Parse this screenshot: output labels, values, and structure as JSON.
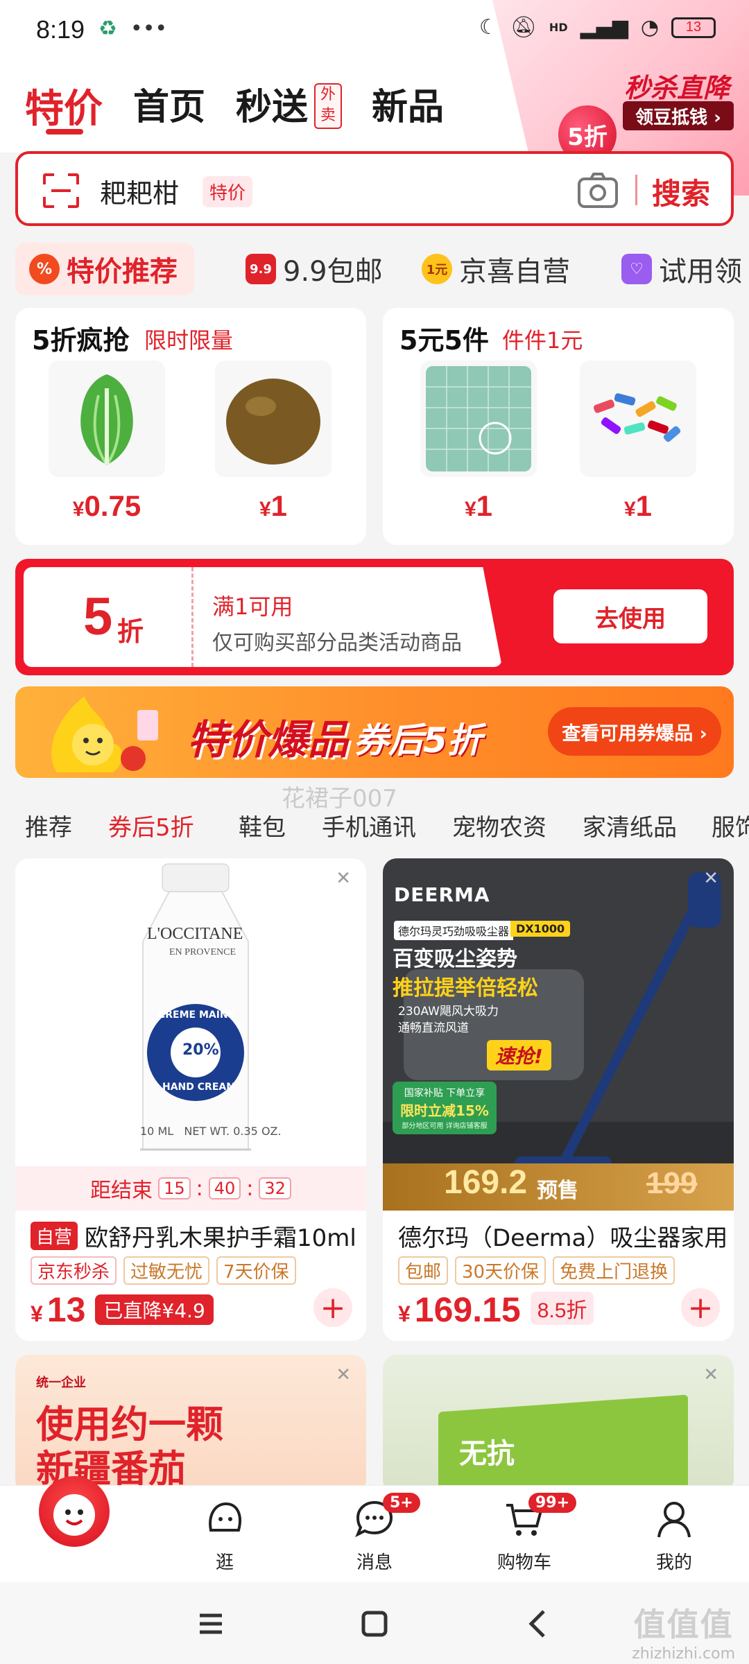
{
  "status_bar": {
    "time": "8:19",
    "battery": "13",
    "network": "HD"
  },
  "header": {
    "tabs": [
      {
        "label": "特价",
        "active": true
      },
      {
        "label": "首页"
      },
      {
        "label": "秒送"
      },
      {
        "label": "新品"
      }
    ],
    "waimai_tag": "外卖",
    "promo": {
      "badge": "5折",
      "title": "秒杀直降",
      "subtitle": "领豆抵钱 ›"
    }
  },
  "search": {
    "query": "耙耙柑",
    "tag": "特价",
    "button": "搜索"
  },
  "categories": [
    {
      "label": "特价推荐",
      "active": true
    },
    {
      "label": "9.9包邮",
      "icon_text": "9.9"
    },
    {
      "label": "京喜自营",
      "icon_text": "1元"
    },
    {
      "label": "试用领"
    }
  ],
  "deals": [
    {
      "title": "5折疯抢",
      "subtitle": "限时限量",
      "items": [
        {
          "price": "0.75",
          "currency": "¥"
        },
        {
          "price": "1",
          "currency": "¥"
        }
      ]
    },
    {
      "title": "5元5件",
      "subtitle": "件件1元",
      "items": [
        {
          "price": "1",
          "currency": "¥"
        },
        {
          "price": "1",
          "currency": "¥"
        }
      ]
    }
  ],
  "coupon": {
    "amount": "5",
    "unit": "折",
    "condition": "满1可用",
    "desc": "仅可购买部分品类活动商品",
    "button": "去使用"
  },
  "banner": {
    "title": "特价爆品",
    "subtitle": "券后5折",
    "button": "查看可用券爆品 ›"
  },
  "watermark": "花裙子007",
  "filters": [
    {
      "label": "推荐"
    },
    {
      "label": "券后5折",
      "active": true
    },
    {
      "label": "鞋包"
    },
    {
      "label": "手机通讯"
    },
    {
      "label": "宠物农资"
    },
    {
      "label": "家清纸品"
    },
    {
      "label": "服饰"
    }
  ],
  "products": [
    {
      "image_brand": "L'OCCITANE",
      "image_sub": "EN PROVENCE",
      "image_product": "CREME MAINS",
      "image_product2": "HAND CREAM",
      "image_pct": "20%",
      "image_size": "10 ML   NET WT. 0.35 OZ.",
      "countdown_label": "距结束",
      "countdown": [
        "15",
        "40",
        "32"
      ],
      "self_tag": "自营",
      "name": "欧舒丹乳木果护手霜10ml",
      "tags": [
        "京东秒杀",
        "过敏无忧",
        "7天价保"
      ],
      "currency": "¥",
      "price": "13",
      "promo": "已直降¥4.9"
    },
    {
      "image_brand": "DEERMA",
      "image_model_label": "德尔玛灵巧劲吸吸尘器",
      "image_model": "DX1000",
      "image_h1": "百变吸尘姿势",
      "image_h2": "推拉提举倍轻松",
      "image_b1": "230AW飓风大吸力",
      "image_b2": "通畅直流风道",
      "image_rush": "速抢!",
      "image_gov1": "国家补贴 下单立享",
      "image_gov2": "限时立减15%",
      "image_gov3": "部分地区可用 详询店铺客服",
      "strip_price": "169.2",
      "strip_label": "预售",
      "strip_orig": "199",
      "name": "德尔玛（Deerma）吸尘器家用",
      "tags": [
        "包邮",
        "30天价保",
        "免费上门退换"
      ],
      "currency": "¥",
      "price": "169.15",
      "discount": "8.5折"
    }
  ],
  "more_products": [
    {
      "brand": "统一企业",
      "headline1": "使用约一颗",
      "headline2": "新疆番茄"
    },
    {
      "headline": "无抗"
    }
  ],
  "bottom_nav": [
    {
      "label": ""
    },
    {
      "label": "逛"
    },
    {
      "label": "消息",
      "badge": "5+"
    },
    {
      "label": "购物车",
      "badge": "99+"
    },
    {
      "label": "我的"
    }
  ],
  "corner_watermark": {
    "title": "值值值",
    "url": "zhizhizhi.com"
  },
  "colors": {
    "brand": "#e0222a",
    "orange": "#ff8d2a"
  }
}
